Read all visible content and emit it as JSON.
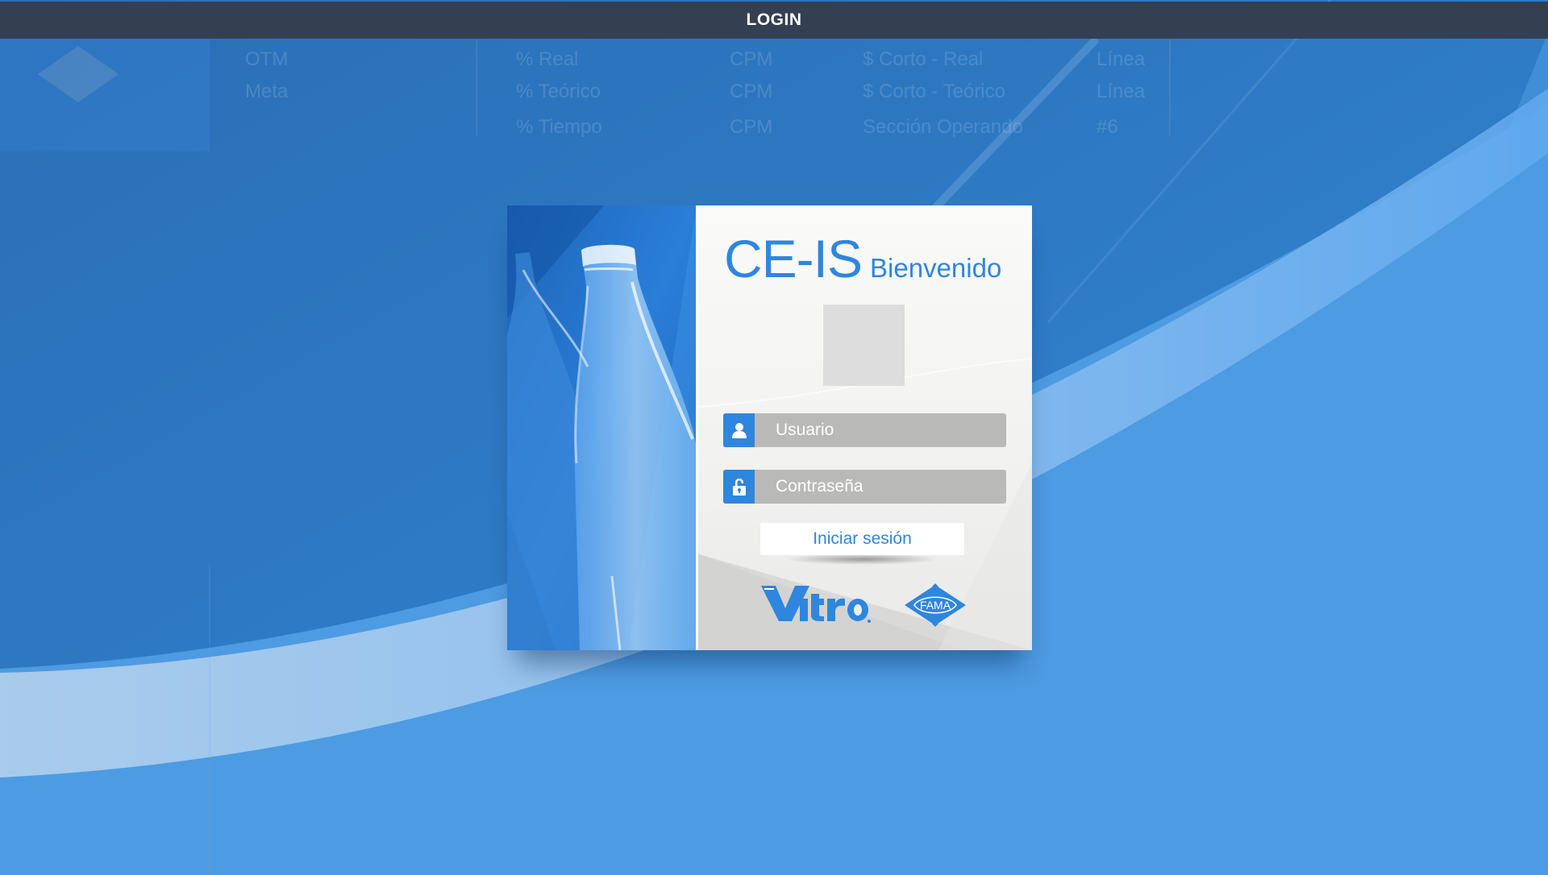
{
  "window": {
    "title": "LOGIN"
  },
  "background_header": {
    "columns": [
      [
        "OTM",
        "Meta"
      ],
      [
        "% Real",
        "% Teórico",
        "% Tiempo"
      ],
      [
        "CPM",
        "CPM",
        "CPM"
      ],
      [
        "$ Corto - Real",
        "$ Corto - Teórico",
        "Sección Operando"
      ],
      [
        "Línea",
        "Línea",
        "#6"
      ]
    ]
  },
  "login": {
    "app_name": "CE-IS",
    "welcome": "Bienvenido",
    "username_placeholder": "Usuario",
    "username_value": "",
    "password_placeholder": "Contraseña",
    "password_value": "",
    "submit_label": "Iniciar sesión"
  },
  "logos": {
    "vitro": "Vitro",
    "fama": "FAMA"
  },
  "colors": {
    "topbar": "#343f52",
    "accent_blue": "#2f86de",
    "background_dark": "#2a72bb",
    "background_light": "#52a0e4",
    "field_gray": "#b9b9b8",
    "avatar_placeholder": "#dddddd"
  },
  "icons": {
    "user": "user-icon",
    "password": "lock-icon"
  }
}
